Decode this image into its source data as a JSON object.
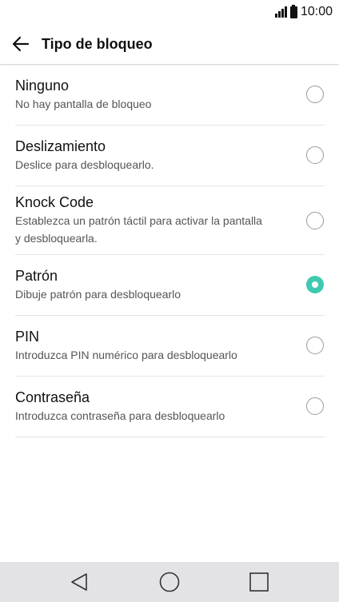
{
  "status_bar": {
    "time": "10:00",
    "icons": [
      "signal-icon",
      "battery-icon"
    ]
  },
  "header": {
    "title": "Tipo de bloqueo",
    "back_icon": "arrow-left-icon"
  },
  "options": [
    {
      "title": "Ninguno",
      "subtitle": "No hay pantalla de bloqueo",
      "selected": false
    },
    {
      "title": "Deslizamiento",
      "subtitle": "Deslice para desbloquearlo.",
      "selected": false
    },
    {
      "title": "Knock Code",
      "subtitle": "Establezca un patrón táctil para activar la pantalla y desbloquearla.",
      "selected": false
    },
    {
      "title": "Patrón",
      "subtitle": "Dibuje patrón para desbloquearlo",
      "selected": true
    },
    {
      "title": "PIN",
      "subtitle": "Introduzca PIN numérico para desbloquearlo",
      "selected": false
    },
    {
      "title": "Contraseña",
      "subtitle": "Introduzca contraseña para desbloquearlo",
      "selected": false
    }
  ],
  "colors": {
    "accent": "#3fc9b1",
    "nav_bar": "#e3e3e6"
  },
  "nav_bar": {
    "icons": [
      "back-triangle-icon",
      "home-circle-icon",
      "recents-square-icon"
    ]
  }
}
